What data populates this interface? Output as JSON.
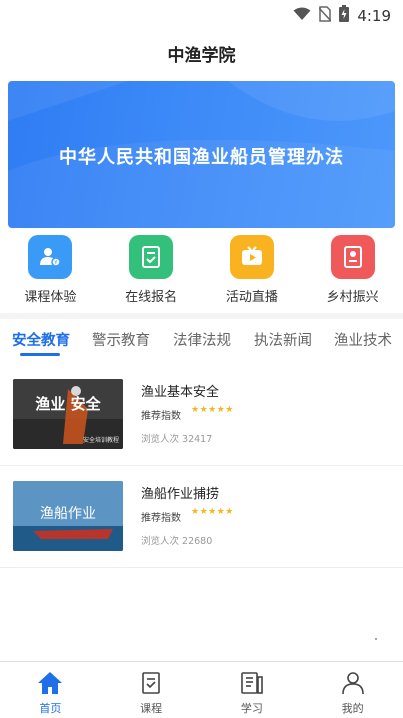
{
  "status_bar": {
    "time": "4:19",
    "icons": [
      "wifi-icon",
      "no-sim-icon",
      "battery-charging-icon"
    ]
  },
  "header": {
    "title": "中渔学院"
  },
  "banner": {
    "text": "中华人民共和国渔业船员管理办法"
  },
  "shortcuts": [
    {
      "label": "课程体验",
      "icon": "course-user-icon",
      "color": "#3a9bf6"
    },
    {
      "label": "在线报名",
      "icon": "checklist-icon",
      "color": "#33c07a"
    },
    {
      "label": "活动直播",
      "icon": "tv-play-icon",
      "color": "#f9b320"
    },
    {
      "label": "乡村振兴",
      "icon": "certificate-icon",
      "color": "#f0595a"
    }
  ],
  "tabs": [
    {
      "label": "安全教育",
      "active": true
    },
    {
      "label": "警示教育",
      "active": false
    },
    {
      "label": "法律法规",
      "active": false
    },
    {
      "label": "执法新闻",
      "active": false
    },
    {
      "label": "渔业技术",
      "active": false
    }
  ],
  "courses": [
    {
      "title": "渔业基本安全",
      "rating_label": "推荐指数",
      "stars": 5,
      "views": "浏览人次 32417",
      "thumb_caption": "渔业 安全",
      "thumb_subcaption": "安全培训教程",
      "thumb_color": "#3b3b3b"
    },
    {
      "title": "渔船作业捕捞",
      "rating_label": "推荐指数",
      "stars": 5,
      "views": "浏览人次 22680",
      "thumb_caption": "渔船作业",
      "thumb_color": "#2e6ca0"
    }
  ],
  "bottom_nav": [
    {
      "label": "首页",
      "icon": "home-icon",
      "active": true
    },
    {
      "label": "课程",
      "icon": "course-icon",
      "active": false
    },
    {
      "label": "学习",
      "icon": "study-icon",
      "active": false
    },
    {
      "label": "我的",
      "icon": "profile-icon",
      "active": false
    }
  ],
  "colors": {
    "accent": "#1e6fe8",
    "star": "#f6b51e",
    "banner": "#3d8af8"
  }
}
